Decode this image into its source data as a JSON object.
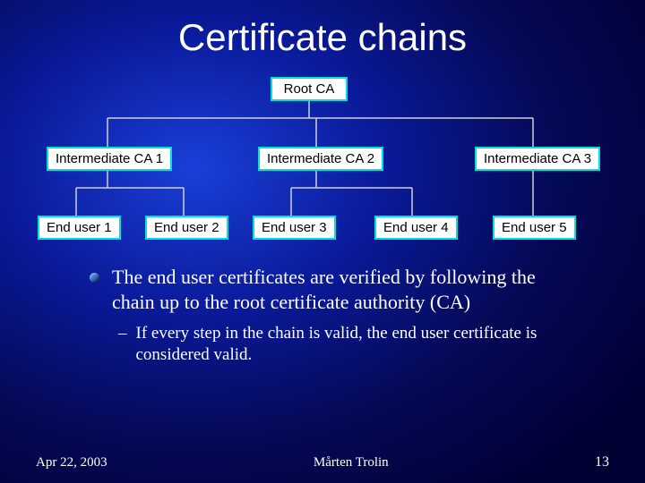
{
  "title": "Certificate chains",
  "chart_data": {
    "type": "tree",
    "root": "Root CA",
    "intermediates": [
      "Intermediate CA 1",
      "Intermediate CA 2",
      "Intermediate CA 3"
    ],
    "end_users": [
      "End user 1",
      "End user 2",
      "End user 3",
      "End user 4",
      "End user 5"
    ],
    "edges_root": [
      [
        0,
        0
      ],
      [
        0,
        1
      ],
      [
        0,
        2
      ]
    ],
    "edges_intermediate_to_end": [
      [
        0,
        0
      ],
      [
        0,
        1
      ],
      [
        1,
        2
      ],
      [
        1,
        3
      ],
      [
        2,
        4
      ]
    ]
  },
  "bullets": {
    "main": "The end user certificates are verified by following the chain up to the root certificate authority (CA)",
    "sub": "If every step in the chain is valid, the end user certificate is considered valid."
  },
  "footer": {
    "date": "Apr 22, 2003",
    "author": "Mårten Trolin",
    "page": "13"
  }
}
